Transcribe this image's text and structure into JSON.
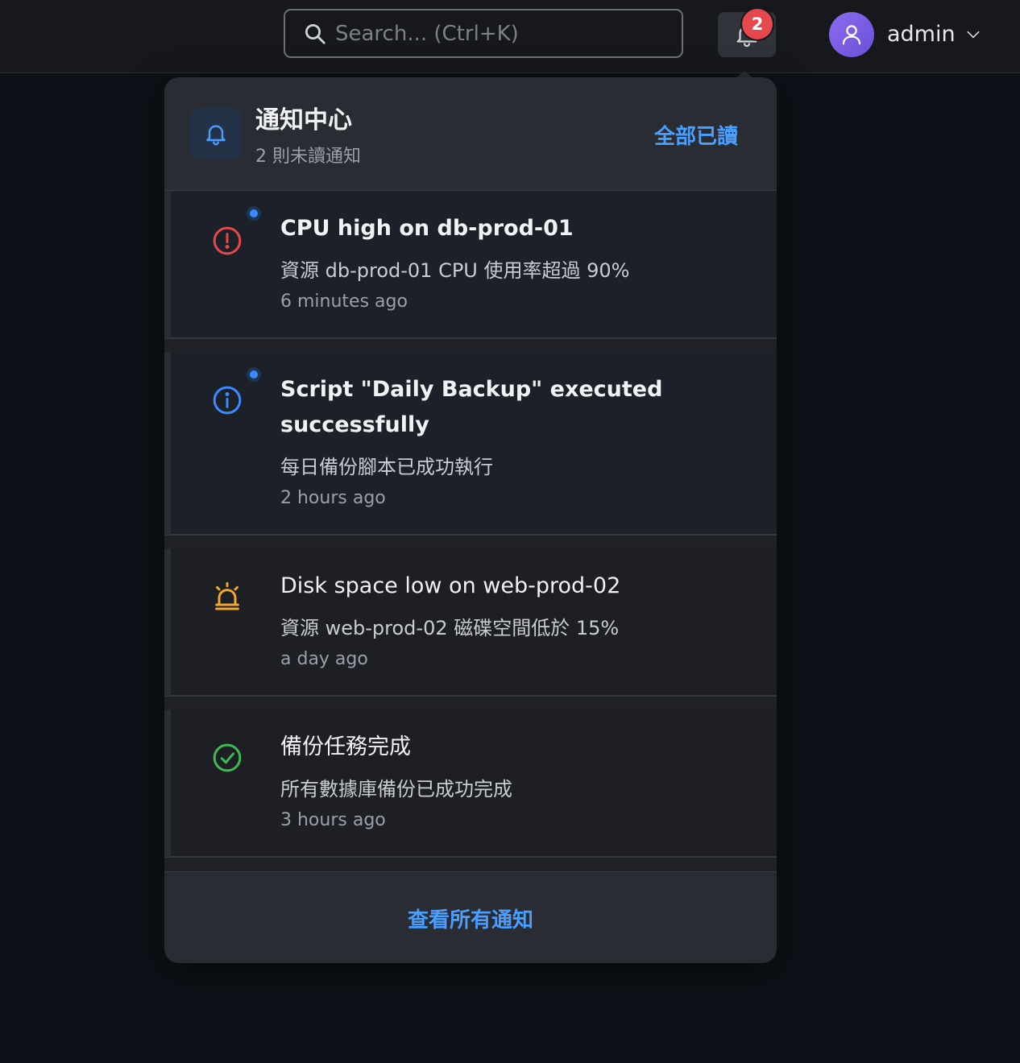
{
  "topbar": {
    "search_placeholder": "Search... (Ctrl+K)",
    "notification_count": "2",
    "username": "admin"
  },
  "panel": {
    "title": "通知中心",
    "subtitle": "2 則未讀通知",
    "mark_all_read": "全部已讀",
    "view_all": "查看所有通知"
  },
  "notifications": [
    {
      "title": "CPU high on db-prod-01",
      "description": "資源 db-prod-01 CPU 使用率超過 90%",
      "time": "6 minutes ago",
      "icon": "error-icon",
      "status_color": "#e5484d",
      "unread": true
    },
    {
      "title": "Script \"Daily Backup\" executed successfully",
      "description": "每日備份腳本已成功執行",
      "time": "2 hours ago",
      "icon": "info-icon",
      "status_color": "#3a8bff",
      "unread": true
    },
    {
      "title": "Disk space low on web-prod-02",
      "description": "資源 web-prod-02 磁碟空間低於 15%",
      "time": "a day ago",
      "icon": "siren-icon",
      "status_color": "#f0a92e",
      "unread": false
    },
    {
      "title": "備份任務完成",
      "description": "所有數據庫備份已成功完成",
      "time": "3 hours ago",
      "icon": "check-circle-icon",
      "status_color": "#3fb950",
      "unread": false
    }
  ],
  "colors": {
    "accent": "#4a9eff",
    "badge": "#e5484d"
  }
}
